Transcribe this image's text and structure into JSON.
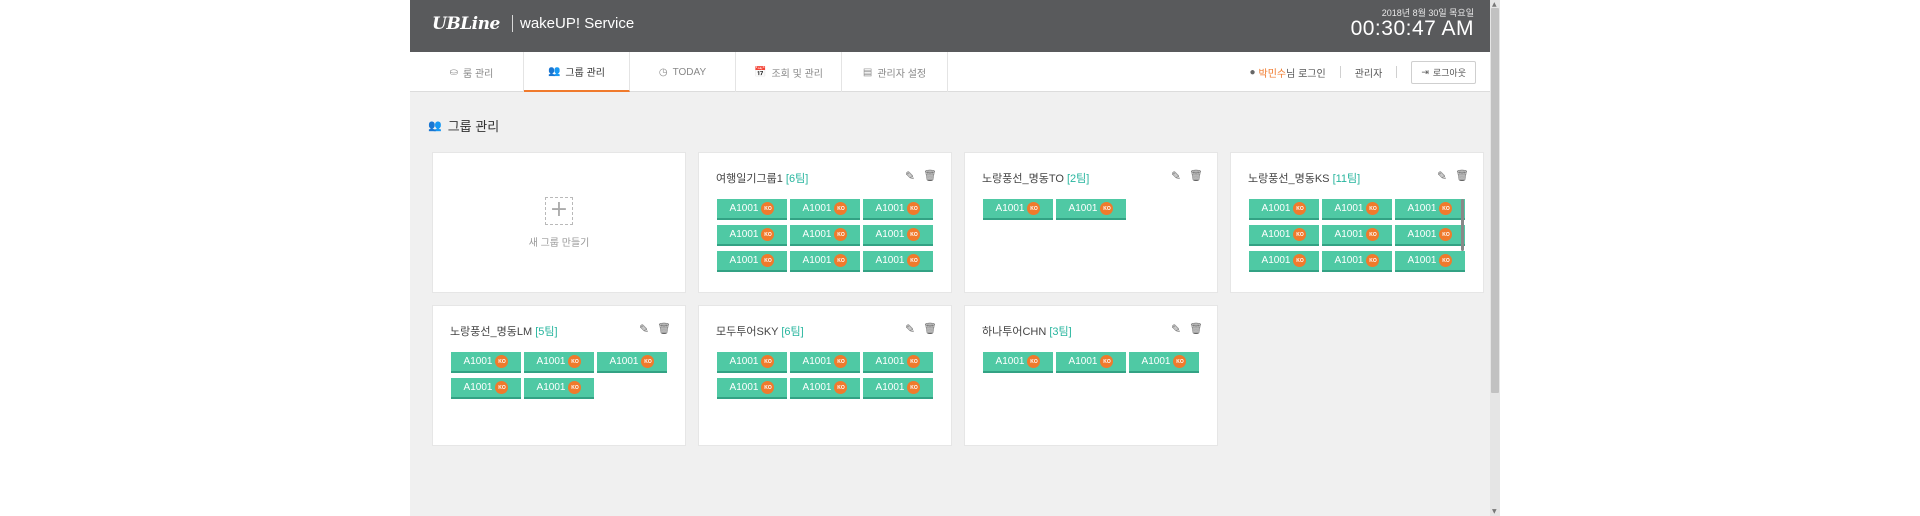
{
  "header": {
    "logo": "UBLine",
    "service_title": "wakeUP! Service",
    "date": "2018년 8월 30일 목요일",
    "time": "00:30:47 AM"
  },
  "nav": {
    "tabs": [
      {
        "label": "룸 관리",
        "icon": "bed-icon",
        "glyph": "⛀"
      },
      {
        "label": "그룹 관리",
        "icon": "users-icon",
        "glyph": "👥"
      },
      {
        "label": "TODAY",
        "icon": "clock-icon",
        "glyph": "◷"
      },
      {
        "label": "조회 및 관리",
        "icon": "calendar-icon",
        "glyph": "📅"
      },
      {
        "label": "관리자 설정",
        "icon": "window-icon",
        "glyph": "▤"
      }
    ],
    "active_tab": "그룹 관리",
    "user": {
      "name": "박민수",
      "suffix": "님 로그인"
    },
    "admin_label": "관리자",
    "logout_label": "로그아웃"
  },
  "page": {
    "title": "그룹 관리",
    "new_group_label": "새 그룹 만들기"
  },
  "chip_badge": "KO",
  "groups": [
    {
      "name": "여행일기그룹1",
      "count": "[6팀]",
      "chips": [
        "A1001",
        "A1001",
        "A1001",
        "A1001",
        "A1001",
        "A1001",
        "A1001",
        "A1001",
        "A1001"
      ]
    },
    {
      "name": "노랑풍선_명동TO",
      "count": "[2팀]",
      "chips": [
        "A1001",
        "A1001"
      ]
    },
    {
      "name": "노랑풍선_명동KS",
      "count": "[11팀]",
      "chips": [
        "A1001",
        "A1001",
        "A1001",
        "A1001",
        "A1001",
        "A1001",
        "A1001",
        "A1001",
        "A1001"
      ]
    },
    {
      "name": "노랑풍선_명동LM",
      "count": "[5팀]",
      "chips": [
        "A1001",
        "A1001",
        "A1001",
        "A1001",
        "A1001"
      ]
    },
    {
      "name": "모두투어SKY",
      "count": "[6팀]",
      "chips": [
        "A1001",
        "A1001",
        "A1001",
        "A1001",
        "A1001",
        "A1001"
      ]
    },
    {
      "name": "하나투어CHN",
      "count": "[3팀]",
      "chips": [
        "A1001",
        "A1001",
        "A1001"
      ]
    }
  ],
  "colors": {
    "header_bg": "#595a5c",
    "accent": "#f07a2c",
    "chip": "#4fc9a4",
    "count_text": "#27b59e"
  }
}
